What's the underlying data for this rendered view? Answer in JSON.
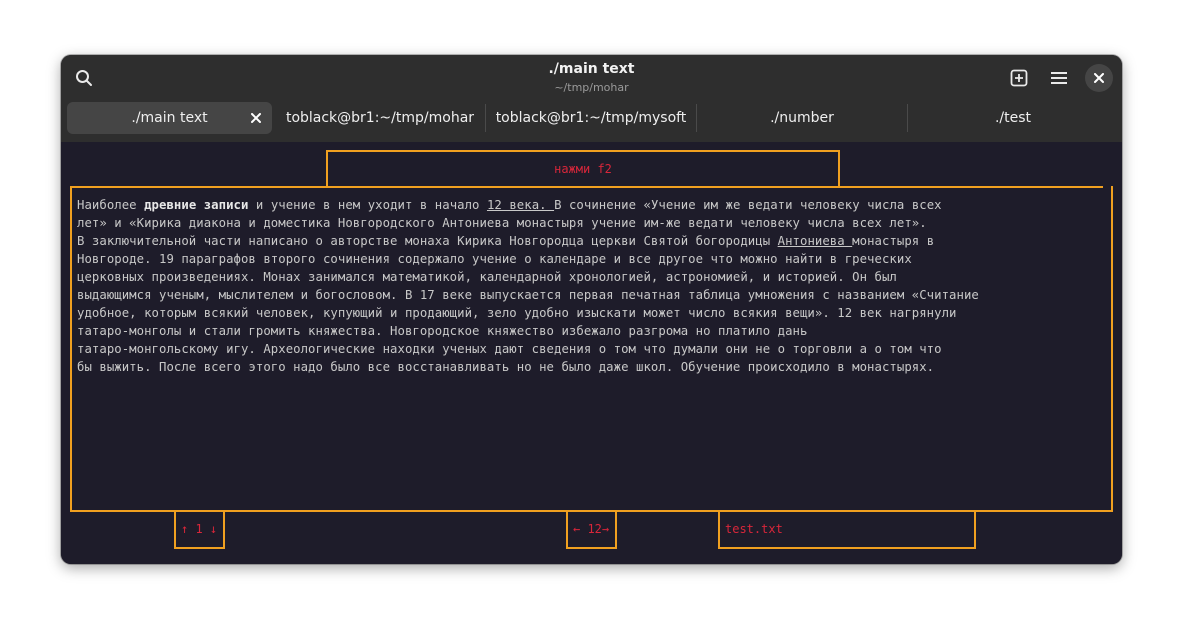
{
  "window": {
    "title": "./main text",
    "subtitle": "~/tmp/mohar"
  },
  "headerbar": {
    "search_icon": "search-icon",
    "new_tab_icon": "new-tab-icon",
    "menu_icon": "hamburger-menu-icon",
    "close_icon": "close-icon"
  },
  "tabs": [
    {
      "label": "./main text",
      "active": true
    },
    {
      "label": "toblack@br1:~/tmp/mohar",
      "active": false
    },
    {
      "label": "toblack@br1:~/tmp/mysoft",
      "active": false
    },
    {
      "label": "./number",
      "active": false
    },
    {
      "label": "./test",
      "active": false
    }
  ],
  "terminal": {
    "hint": "нажми f2",
    "text": {
      "l1_a": "Наиболее ",
      "l1_b": "древние записи",
      "l1_c": " и учение в нем уходит в начало ",
      "l1_d": "12 века. ",
      "l1_e": "В сочинение «Учение им же ведати человеку числа всех",
      "l2": "лет» и «Кирика диакона и доместика Новгородского Антониева монастыря учение им-же ведати человеку числа всех лет».",
      "l3_a": "В заключительной части написано о авторстве монаха Кирика Новгородца церкви Святой богородицы ",
      "l3_b": "Антониева ",
      "l3_c": "монастыря в",
      "l4": "Новгороде. 19 параграфов второго сочинения содержало учение о календаре и все другое что можно найти в греческих",
      "l5": "церковных произведениях. Монах занимался математикой, календарной хронологией, астрономией, и историей. Он был",
      "l6": "выдающимся ученым, мыслителем и богословом. В 17 веке выпускается первая печатная таблица умножения с названием «Считание",
      "l7": "удобное, которым всякий человек, купующий и продающий, зело удобно изыскати может число всякия вещи». 12 век нагрянули",
      "l8": "татаро-монголы и стали громить княжества. Новгородское княжество избежало разгрома но платило дань",
      "l9": "татаро-монгольскому игу. Археологические находки ученых дают сведения о том что думали они не о торговли а о том что",
      "l10": "бы выжить. После всего этого надо было все восстанавливать но не было даже школ. Обучение происходило в монастырях."
    },
    "status": {
      "line": "↑ 1 ↓",
      "column": "← 12→",
      "file": "test.txt"
    }
  },
  "colors": {
    "border_accent": "#f0a020",
    "status_text": "#d8263a",
    "terminal_bg": "#1e1c2a",
    "headerbar_bg": "#2e2e2e"
  }
}
